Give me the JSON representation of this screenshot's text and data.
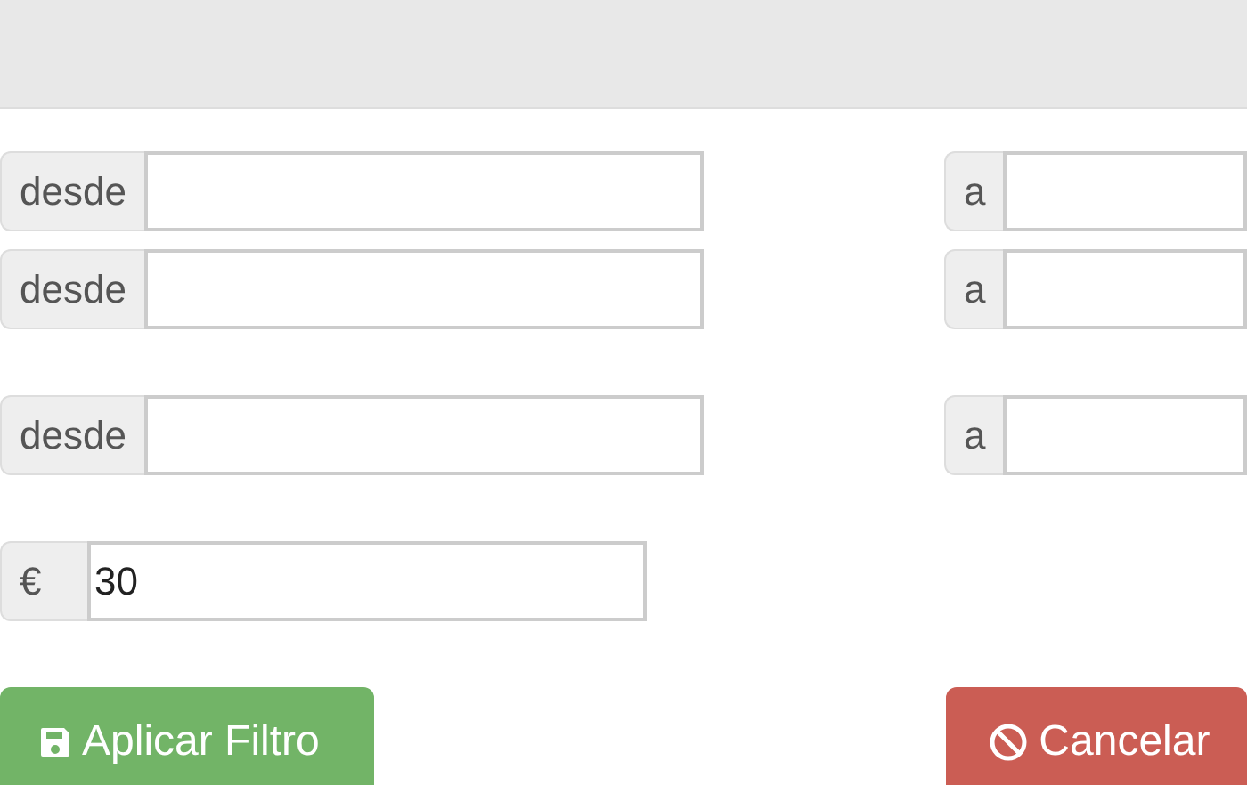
{
  "range_groups": [
    {
      "rows": [
        {
          "from_label": "desde",
          "from_value": "",
          "to_label": "a",
          "to_value": ""
        },
        {
          "from_label": "desde",
          "from_value": "",
          "to_label": "a",
          "to_value": ""
        }
      ]
    },
    {
      "rows": [
        {
          "from_label": "desde",
          "from_value": "",
          "to_label": "a",
          "to_value": ""
        }
      ]
    }
  ],
  "price_field": {
    "addon": "€",
    "value": "30"
  },
  "buttons": [
    {
      "kind": "apply",
      "label": "Aplicar Filtro"
    },
    {
      "kind": "cancel",
      "label": "Cancelar"
    }
  ]
}
